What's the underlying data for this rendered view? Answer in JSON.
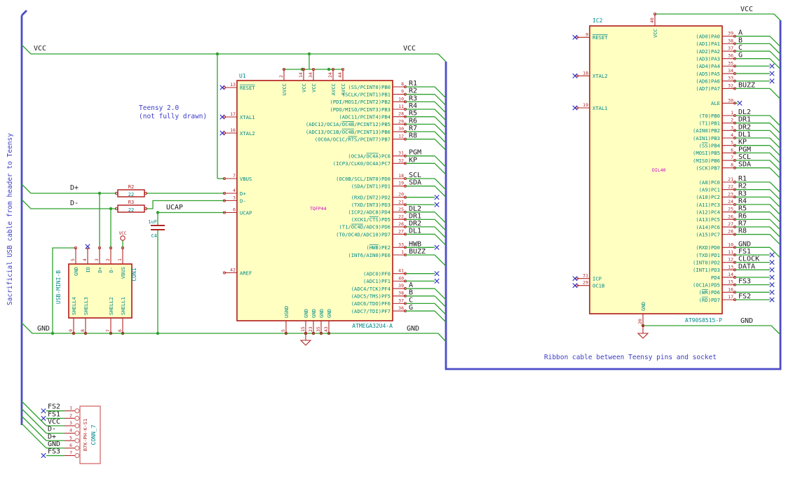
{
  "notes": {
    "side_note": "Sacrificial USB cable from header to Teensy",
    "teensy_note_1": "Teensy 2.0",
    "teensy_note_2": "(not fully drawn)",
    "ribbon_note": "Ribbon cable between Teensy pins and socket"
  },
  "labels": {
    "vcc": "VCC",
    "gnd": "GND",
    "dplus": "D+",
    "dminus": "D-",
    "ucap": "UCAP"
  },
  "colors": {
    "wire_green": "#2da12d",
    "bus_blue": "#4c4cc8",
    "component_outline": "#b01818",
    "component_fill": "#ffffc2",
    "pin_red": "#b42424",
    "pin_name_teal": "#008989",
    "variant_magenta": "#c800c8",
    "note_blue": "#3c3cc8",
    "no_connect_blue": "#3a3ac8",
    "net_label_black": "#1a1a1a"
  },
  "u1": {
    "ref": "U1",
    "part": "ATMEGA32U4-A",
    "variant": "TQFP44",
    "top_pins": [
      {
        "num": "2",
        "name": "UVCC"
      },
      {
        "num": "14",
        "name": "VCC"
      },
      {
        "num": "34",
        "name": "VCC"
      },
      {
        "num": "24",
        "name": "AVCC"
      },
      {
        "num": "44",
        "name": "AVCC"
      }
    ],
    "bottom_pins": [
      {
        "num": "5",
        "name": "UGND"
      },
      {
        "num": "15",
        "name": "GND"
      },
      {
        "num": "23",
        "name": "GND"
      },
      {
        "num": "35",
        "name": "GND"
      },
      {
        "num": "43",
        "name": "GND"
      }
    ],
    "left_pins": [
      {
        "num": "13",
        "name": "~RESET~",
        "term": "nc"
      },
      {
        "num": "17",
        "name": "XTAL1",
        "term": "nc"
      },
      {
        "num": "16",
        "name": "XTAL2",
        "term": "nc"
      },
      {
        "num": "7",
        "name": "VBUS",
        "term": "none"
      },
      {
        "num": "4",
        "name": "D+",
        "term": "none"
      },
      {
        "num": "3",
        "name": "D-",
        "term": "none"
      },
      {
        "num": "6",
        "name": "UCAP",
        "term": "none"
      },
      {
        "num": "42",
        "name": "AREF",
        "term": "none"
      }
    ],
    "right_pb": [
      {
        "num": "8",
        "name": "(SS/PCINT0)PB0",
        "net": "R1",
        "term": "bus"
      },
      {
        "num": "9",
        "name": "(SCLK/PCINT1)PB1",
        "net": "R2",
        "term": "bus"
      },
      {
        "num": "10",
        "name": "(PDI/MOSI/PCINT2)PB2",
        "net": "R3",
        "term": "bus"
      },
      {
        "num": "11",
        "name": "(PDO/MISO/PCINT3)PB3",
        "net": "R4",
        "term": "bus"
      },
      {
        "num": "28",
        "name": "(ADC11/PCINT4)PB4",
        "net": "R5",
        "term": "bus"
      },
      {
        "num": "29",
        "name": "(ADC12/OC1A/~OC4B~/PCINT12)PB5",
        "net": "R6",
        "term": "bus"
      },
      {
        "num": "30",
        "name": "(ADC13/OC1B/~OC4B~/PCINT13)PB6",
        "net": "R7",
        "term": "bus"
      },
      {
        "num": "12",
        "name": "(OC0A/OC1C/~RTS~/PCINT7)PB7",
        "net": "R8",
        "term": "bus"
      }
    ],
    "right_pc": [
      {
        "num": "31",
        "name": "(OC3A/~OC4A~)PC6",
        "net": "PGM",
        "term": "bus"
      },
      {
        "num": "32",
        "name": "(ICP3/CLK0/OC4A)PC7",
        "net": "KP",
        "term": "bus"
      }
    ],
    "right_pd1": [
      {
        "num": "18",
        "name": "(OC0B/SCL/INT0)PD0",
        "net": "SCL",
        "term": "bus"
      },
      {
        "num": "19",
        "name": "(SDA/INT1)PD1",
        "net": "SDA",
        "term": "bus"
      }
    ],
    "right_pd2": [
      {
        "num": "20",
        "name": "(RXD/INT2)PD2",
        "net": null,
        "term": "nc"
      },
      {
        "num": "21",
        "name": "(TXD/INT3)PD3",
        "net": null,
        "term": "nc"
      },
      {
        "num": "25",
        "name": "(ICP2/ADC8)PD4",
        "net": "DL2",
        "term": "bus"
      },
      {
        "num": "22",
        "name": "(XCK1/~CTS~)PD5",
        "net": "DR1",
        "term": "bus"
      },
      {
        "num": "26",
        "name": "(T1/~OC4D~/ADC9)PD6",
        "net": "DR2",
        "term": "bus"
      },
      {
        "num": "27",
        "name": "(T0/OC4D/ADC10)PD7",
        "net": "DL1",
        "term": "bus"
      }
    ],
    "right_pe": [
      {
        "num": "33",
        "name": "(~HWB~)PE2",
        "net": "HWB",
        "term": "nc"
      },
      {
        "num": "1",
        "name": "(INT6/AIN0)PE6",
        "net": "BUZZ",
        "term": "bus"
      }
    ],
    "right_pf": [
      {
        "num": "41",
        "name": "(ADC0)PF0",
        "net": null,
        "term": "nc"
      },
      {
        "num": "40",
        "name": "(ADC1)PF1",
        "net": null,
        "term": "nc"
      },
      {
        "num": "39",
        "name": "(ADC4/TCK)PF4",
        "net": "A",
        "term": "bus"
      },
      {
        "num": "38",
        "name": "(ADC5/TMS)PF5",
        "net": "B",
        "term": "bus"
      },
      {
        "num": "37",
        "name": "(ADC6/TDO)PF6",
        "net": "C",
        "term": "bus"
      },
      {
        "num": "36",
        "name": "(ADC7/TDI)PF7",
        "net": "G",
        "term": "bus"
      }
    ]
  },
  "ic2": {
    "ref": "IC2",
    "part": "AT90S8515-P",
    "variant": "DIL40",
    "top_pins": [
      {
        "num": "40",
        "name": "VCC"
      }
    ],
    "bottom_pins": [
      {
        "num": "20",
        "name": "GND"
      }
    ],
    "left_pins": [
      {
        "num": "9",
        "name": "~RESET~",
        "term": "nc"
      },
      {
        "num": "18",
        "name": "XTAL2",
        "term": "nc"
      },
      {
        "num": "19",
        "name": "XTAL1",
        "term": "nc"
      },
      {
        "num": "31",
        "name": "ICP",
        "term": "nc"
      },
      {
        "num": "29",
        "name": "OC1B",
        "term": "nc"
      }
    ],
    "right_pa": [
      {
        "num": "39",
        "name": "(AD0)PA0",
        "net": "A",
        "term": "bus"
      },
      {
        "num": "38",
        "name": "(AD1)PA1",
        "net": "B",
        "term": "bus"
      },
      {
        "num": "37",
        "name": "(AD2)PA2",
        "net": "C",
        "term": "bus"
      },
      {
        "num": "36",
        "name": "(AD3)PA3",
        "net": "G",
        "term": "bus"
      },
      {
        "num": "35",
        "name": "(AD4)PA4",
        "net": null,
        "term": "nc"
      },
      {
        "num": "34",
        "name": "(AD5)PA5",
        "net": null,
        "term": "nc"
      },
      {
        "num": "33",
        "name": "(AD6)PA6",
        "net": null,
        "term": "nc"
      },
      {
        "num": "32",
        "name": "(AD7)PA7",
        "net": "BUZZ",
        "term": "bus"
      }
    ],
    "right_ale": [
      {
        "num": "30",
        "name": "ALE",
        "net": null,
        "term": "nc"
      }
    ],
    "right_pb": [
      {
        "num": "1",
        "name": "(T0)PB0",
        "net": "DL2",
        "term": "bus"
      },
      {
        "num": "2",
        "name": "(T1)PB1",
        "net": "DR1",
        "term": "bus"
      },
      {
        "num": "3",
        "name": "(AIN0)PB2",
        "net": "DR2",
        "term": "bus"
      },
      {
        "num": "4",
        "name": "(AIN1)PB3",
        "net": "DL1",
        "term": "bus"
      },
      {
        "num": "5",
        "name": "(~SS~)PB4",
        "net": "KP",
        "term": "bus"
      },
      {
        "num": "6",
        "name": "(MOSI)PB5",
        "net": "PGM",
        "term": "bus"
      },
      {
        "num": "7",
        "name": "(MISO)PB6",
        "net": "SCL",
        "term": "bus"
      },
      {
        "num": "8",
        "name": "(SCK)PB7",
        "net": "SDA",
        "term": "bus"
      }
    ],
    "right_pc": [
      {
        "num": "21",
        "name": "(A8)PC0",
        "net": "R1",
        "term": "bus"
      },
      {
        "num": "22",
        "name": "(A9)PC1",
        "net": "R2",
        "term": "bus"
      },
      {
        "num": "23",
        "name": "(A10)PC2",
        "net": "R3",
        "term": "bus"
      },
      {
        "num": "24",
        "name": "(A11)PC3",
        "net": "R4",
        "term": "bus"
      },
      {
        "num": "25",
        "name": "(A12)PC4",
        "net": "R5",
        "term": "bus"
      },
      {
        "num": "26",
        "name": "(A13)PC5",
        "net": "R6",
        "term": "bus"
      },
      {
        "num": "27",
        "name": "(A14)PC6",
        "net": "R7",
        "term": "bus"
      },
      {
        "num": "28",
        "name": "(A15)PC7",
        "net": "R8",
        "term": "bus"
      }
    ],
    "right_pd": [
      {
        "num": "10",
        "name": "(RXD)PD0",
        "net": "GND",
        "term": "bus"
      },
      {
        "num": "11",
        "name": "(TXD)PD1",
        "net": "FS1",
        "term": "nc"
      },
      {
        "num": "12",
        "name": "(INT0)PD2",
        "net": "CLOCK",
        "term": "nc"
      },
      {
        "num": "13",
        "name": "(INT1)PD3",
        "net": "DATA",
        "term": "nc"
      },
      {
        "num": "14",
        "name": "PD4",
        "net": null,
        "term": "nc"
      },
      {
        "num": "15",
        "name": "(OC1A)PD5",
        "net": "FS3",
        "term": "nc"
      },
      {
        "num": "16",
        "name": "(~WR~)PD6",
        "net": null,
        "term": "nc"
      },
      {
        "num": "17",
        "name": "(~RD~)PD7",
        "net": "FS2",
        "term": "nc"
      }
    ]
  },
  "usb": {
    "ref": "CON1",
    "part": "USB-MINI-B",
    "top_pins": [
      {
        "num": "5",
        "name": "GND",
        "term": "none"
      },
      {
        "num": "4",
        "name": "ID",
        "term": "nc"
      },
      {
        "num": "3",
        "name": "D+",
        "term": "none"
      },
      {
        "num": "2",
        "name": "D-",
        "term": "none"
      },
      {
        "num": "1",
        "name": "VBUS",
        "term": "none"
      }
    ],
    "bottom_pins": [
      {
        "num": "9",
        "name": "SHELL4"
      },
      {
        "num": "8",
        "name": "SHELL3"
      },
      {
        "num": "7",
        "name": "SHELL2"
      },
      {
        "num": "6",
        "name": "SHELL1"
      }
    ]
  },
  "conn7": {
    "ref": "CONN_7",
    "part": "B7K-PH-K-S1",
    "pins": [
      {
        "num": "1",
        "net": "FS2",
        "term": "nc"
      },
      {
        "num": "2",
        "net": "FS1",
        "term": "nc"
      },
      {
        "num": "3",
        "net": "VCC",
        "term": "bus"
      },
      {
        "num": "4",
        "net": "D-",
        "term": "bus"
      },
      {
        "num": "5",
        "net": "D+",
        "term": "bus"
      },
      {
        "num": "6",
        "net": "GND",
        "term": "bus"
      },
      {
        "num": "7",
        "net": "FS3",
        "term": "nc"
      }
    ]
  },
  "r2": {
    "ref": "R2",
    "value": "22"
  },
  "r3": {
    "ref": "R3",
    "value": "22"
  },
  "c4": {
    "ref": "C4",
    "value": "1uF"
  }
}
